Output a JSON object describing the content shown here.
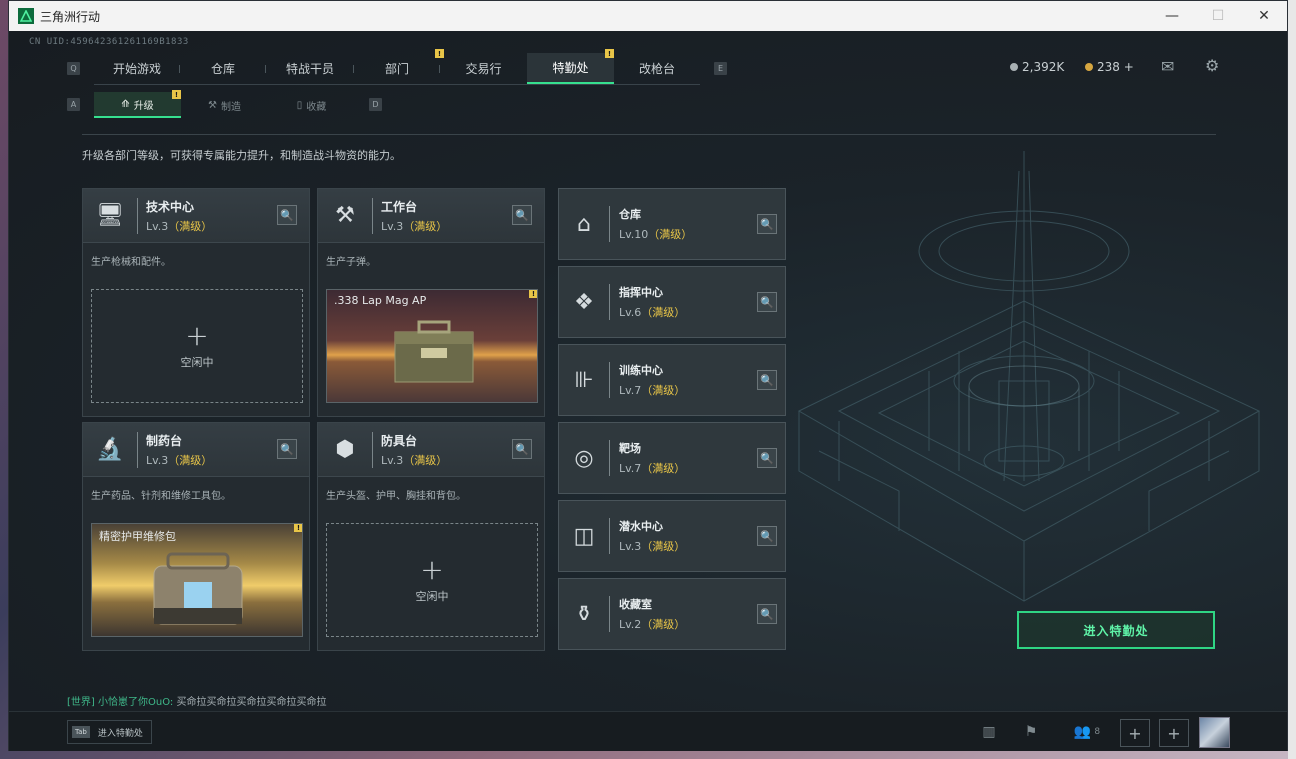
{
  "window": {
    "title": "三角洲行动",
    "minimize": "—",
    "maximize": "☐",
    "close": "✕"
  },
  "uid": "CN UID:459642361261169B1833",
  "topnav": {
    "key_left": "Q",
    "key_right": "E",
    "tabs": [
      {
        "label": "开始游戏"
      },
      {
        "label": "仓库"
      },
      {
        "label": "特战干员"
      },
      {
        "label": "部门",
        "badge": "!"
      },
      {
        "label": "交易行"
      },
      {
        "label": "特勤处",
        "badge": "!",
        "active": true
      },
      {
        "label": "改枪台"
      }
    ]
  },
  "currency": {
    "silver": "2,392K",
    "gold": "238 +"
  },
  "subnav": {
    "key_left": "A",
    "key_right": "D",
    "tabs": [
      {
        "label": "升级",
        "icon": "upgrade-icon",
        "badge": "!",
        "active": true
      },
      {
        "label": "制造",
        "icon": "craft-icon"
      },
      {
        "label": "收藏",
        "icon": "collection-icon"
      }
    ]
  },
  "description": "升级各部门等级，可获得专属能力提升，和制造战斗物资的能力。",
  "stations": [
    {
      "name": "技术中心",
      "level": "Lv.3",
      "status": "（满级）",
      "desc": "生产枪械和配件。",
      "icon": "tech-center-icon",
      "slot": "空闲中"
    },
    {
      "name": "工作台",
      "level": "Lv.3",
      "status": "（满级）",
      "desc": "生产子弹。",
      "icon": "workbench-icon",
      "product": ".338 Lap Mag AP",
      "product_badge": "!"
    },
    {
      "name": "制药台",
      "level": "Lv.3",
      "status": "（满级）",
      "desc": "生产药品、针剂和维修工具包。",
      "icon": "pharmacy-icon",
      "product": "精密护甲维修包",
      "product_badge": "!"
    },
    {
      "name": "防具台",
      "level": "Lv.3",
      "status": "（满级）",
      "desc": "生产头盔、护甲、胸挂和背包。",
      "icon": "armor-bench-icon",
      "slot": "空闲中"
    }
  ],
  "facilities": [
    {
      "name": "仓库",
      "level": "Lv.10",
      "status": "（满级）",
      "icon": "warehouse-icon"
    },
    {
      "name": "指挥中心",
      "level": "Lv.6",
      "status": "（满级）",
      "icon": "command-center-icon"
    },
    {
      "name": "训练中心",
      "level": "Lv.7",
      "status": "（满级）",
      "icon": "training-center-icon"
    },
    {
      "name": "靶场",
      "level": "Lv.7",
      "status": "（满级）",
      "icon": "shooting-range-icon"
    },
    {
      "name": "潜水中心",
      "level": "Lv.3",
      "status": "（满级）",
      "icon": "diving-center-icon"
    },
    {
      "name": "收藏室",
      "level": "Lv.2",
      "status": "（满级）",
      "icon": "collection-room-icon"
    }
  ],
  "enter_button": "进入特勤处",
  "chat": {
    "channel": "[世界]",
    "user": "小恰崽了你OuO:",
    "message": "买命拉买命拉买命拉买命拉买命拉"
  },
  "bottom": {
    "tab_key": "Tab",
    "tab_label": "进入特勤处",
    "friends_count": "8"
  },
  "colors": {
    "accent": "#36e08f",
    "max_level": "#e8c548",
    "badge": "#e8c548"
  }
}
